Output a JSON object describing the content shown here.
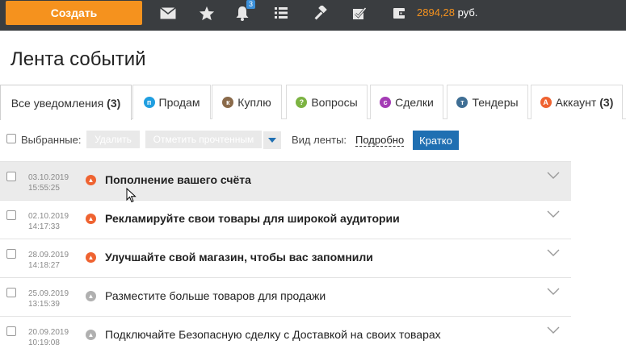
{
  "header": {
    "create_label": "Создать",
    "bell_count": "3",
    "balance_amount": "2894,28",
    "balance_currency": "руб.",
    "icons": [
      "mail-icon",
      "star-icon",
      "bell-icon",
      "list-icon",
      "hammer-icon",
      "checkbox-icon",
      "wallet-icon"
    ]
  },
  "page": {
    "title": "Лента событий"
  },
  "tabs": [
    {
      "label": "Все уведомления",
      "count": "(3)",
      "icon_letter": "",
      "color": ""
    },
    {
      "label": "Продам",
      "count": "",
      "icon_letter": "п",
      "color": "#1f9ee0"
    },
    {
      "label": "Куплю",
      "count": "",
      "icon_letter": "к",
      "color": "#8a6a4a"
    },
    {
      "label": "Вопросы",
      "count": "",
      "icon_letter": "?",
      "color": "#7cb342"
    },
    {
      "label": "Сделки",
      "count": "",
      "icon_letter": "с",
      "color": "#a43bb5"
    },
    {
      "label": "Тендеры",
      "count": "",
      "icon_letter": "т",
      "color": "#3f6e94"
    },
    {
      "label": "Аккаунт",
      "count": "(3)",
      "icon_letter": "А",
      "color": "#ef6331"
    }
  ],
  "toolbar": {
    "selected_label": "Выбранные:",
    "delete_label": "Удалить",
    "mark_read_label": "Отметить прочтенным",
    "view_label": "Вид ленты:",
    "view_detailed": "Подробно",
    "view_short": "Кратко"
  },
  "rows": [
    {
      "date": "03.10.2019",
      "time": "15:55:25",
      "text": "Пополнение вашего счёта",
      "unread": true
    },
    {
      "date": "02.10.2019",
      "time": "14:17:33",
      "text": "Рекламируйте свои товары для широкой аудитории",
      "unread": true
    },
    {
      "date": "28.09.2019",
      "time": "14:18:27",
      "text": "Улучшайте свой магазин, чтобы вас запомнили",
      "unread": true
    },
    {
      "date": "25.09.2019",
      "time": "13:15:39",
      "text": "Разместите больше товаров для продажи",
      "unread": false
    },
    {
      "date": "20.09.2019",
      "time": "10:19:08",
      "text": "Подключайте Безопасную сделку с Доставкой на своих товарах",
      "unread": false
    }
  ],
  "colors": {
    "accent_orange": "#f5921e",
    "topbar": "#3a3d40",
    "primary_blue": "#1f6fb2",
    "unread_icon": "#ef6331",
    "read_icon": "#b0b0b0"
  }
}
